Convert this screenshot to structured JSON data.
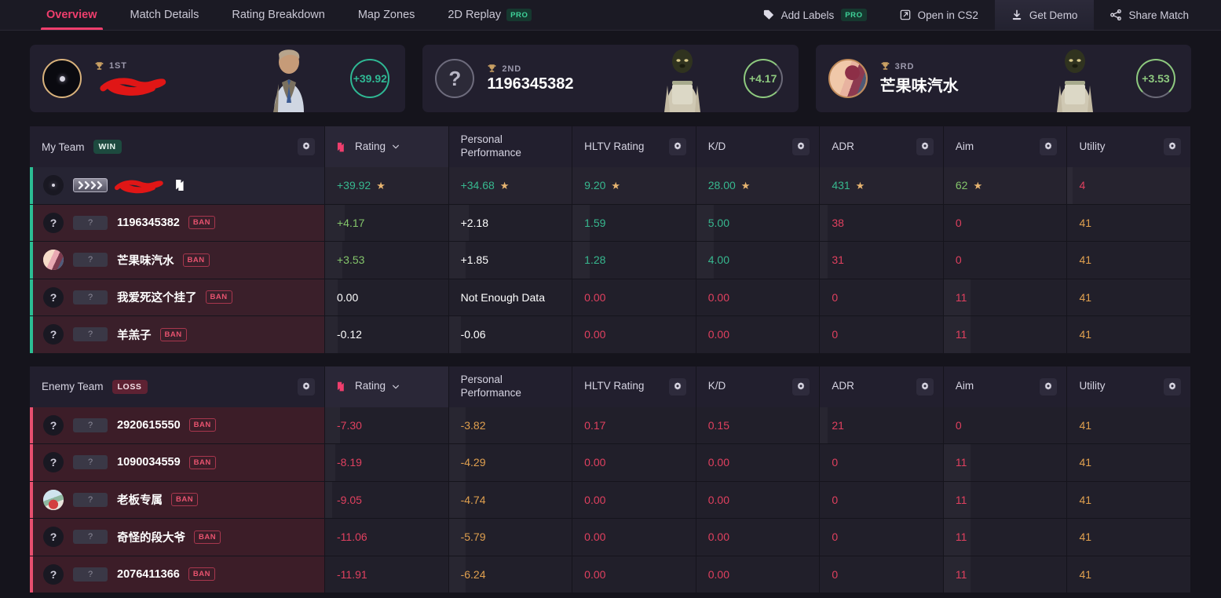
{
  "nav": {
    "tabs": [
      {
        "label": "Overview",
        "active": true,
        "badge": null
      },
      {
        "label": "Match Details",
        "active": false,
        "badge": null
      },
      {
        "label": "Rating Breakdown",
        "active": false,
        "badge": null
      },
      {
        "label": "Map Zones",
        "active": false,
        "badge": null
      },
      {
        "label": "2D Replay",
        "active": false,
        "badge": "PRO"
      }
    ],
    "actions": [
      {
        "label": "Add Labels",
        "icon": "tag-icon",
        "badge": "PRO"
      },
      {
        "label": "Open in CS2",
        "icon": "external-link-icon",
        "badge": null
      },
      {
        "label": "Get Demo",
        "icon": "download-icon",
        "badge": null
      },
      {
        "label": "Share Match",
        "icon": "share-icon",
        "badge": null
      }
    ]
  },
  "podium": [
    {
      "rank": "1ST",
      "name": "",
      "name_redacted": true,
      "score": "+39.92",
      "avatar": "dark-scope"
    },
    {
      "rank": "2ND",
      "name": "1196345382",
      "name_redacted": false,
      "score": "+4.17",
      "avatar": "question-mark"
    },
    {
      "rank": "3RD",
      "name": "芒果味汽水",
      "name_redacted": false,
      "score": "+3.53",
      "avatar": "photo"
    }
  ],
  "columns": [
    {
      "label": "Rating",
      "icon": "leetify-icon",
      "sortable": true,
      "sorted": true,
      "gear": false
    },
    {
      "label": "Personal Performance",
      "icon": null,
      "sortable": false,
      "sorted": false,
      "gear": false
    },
    {
      "label": "HLTV Rating",
      "icon": null,
      "sortable": false,
      "sorted": false,
      "gear": true
    },
    {
      "label": "K/D",
      "icon": null,
      "sortable": false,
      "sorted": false,
      "gear": true
    },
    {
      "label": "ADR",
      "icon": null,
      "sortable": false,
      "sorted": false,
      "gear": true
    },
    {
      "label": "Aim",
      "icon": null,
      "sortable": false,
      "sorted": false,
      "gear": true
    },
    {
      "label": "Utility",
      "icon": null,
      "sortable": false,
      "sorted": false,
      "gear": true
    }
  ],
  "teams": [
    {
      "name": "My Team",
      "result": "WIN",
      "result_type": "win",
      "players": [
        {
          "name": "",
          "name_redacted": true,
          "avatar": "dark-scope",
          "rank_badge": "chevrons",
          "ban": null,
          "is_me": true,
          "stats": [
            {
              "value": "+39.92",
              "color": "green",
              "star": true,
              "bar": 0
            },
            {
              "value": "+34.68",
              "color": "green",
              "star": true,
              "bar": 0
            },
            {
              "value": "9.20",
              "color": "green",
              "star": true,
              "bar": 0
            },
            {
              "value": "28.00",
              "color": "green",
              "star": true,
              "bar": 0
            },
            {
              "value": "431",
              "color": "green",
              "star": true,
              "bar": 0
            },
            {
              "value": "62",
              "color": "lgreen",
              "star": true,
              "bar": 0
            },
            {
              "value": "4",
              "color": "red",
              "star": false,
              "bar": 4
            }
          ]
        },
        {
          "name": "1196345382",
          "name_redacted": false,
          "avatar": "question",
          "rank_badge": "?",
          "ban": "BAN",
          "is_me": false,
          "stats": [
            {
              "value": "+4.17",
              "color": "lgreen",
              "star": false,
              "bar": 16
            },
            {
              "value": "+2.18",
              "color": "white",
              "star": false,
              "bar": 16
            },
            {
              "value": "1.59",
              "color": "green",
              "star": false,
              "bar": 14
            },
            {
              "value": "5.00",
              "color": "green",
              "star": false,
              "bar": 14
            },
            {
              "value": "38",
              "color": "red",
              "star": false,
              "bar": 6
            },
            {
              "value": "0",
              "color": "red",
              "star": false,
              "bar": 0
            },
            {
              "value": "41",
              "color": "orange",
              "star": false,
              "bar": 0
            }
          ]
        },
        {
          "name": "芒果味汽水",
          "name_redacted": false,
          "avatar": "photo1",
          "rank_badge": "?",
          "ban": "BAN",
          "is_me": false,
          "stats": [
            {
              "value": "+3.53",
              "color": "lgreen",
              "star": false,
              "bar": 14
            },
            {
              "value": "+1.85",
              "color": "white",
              "star": false,
              "bar": 14
            },
            {
              "value": "1.28",
              "color": "green",
              "star": false,
              "bar": 14
            },
            {
              "value": "4.00",
              "color": "green",
              "star": false,
              "bar": 14
            },
            {
              "value": "31",
              "color": "red",
              "star": false,
              "bar": 6
            },
            {
              "value": "0",
              "color": "red",
              "star": false,
              "bar": 0
            },
            {
              "value": "41",
              "color": "orange",
              "star": false,
              "bar": 0
            }
          ]
        },
        {
          "name": "我爱死这个挂了",
          "name_redacted": false,
          "avatar": "question",
          "rank_badge": "?",
          "ban": "BAN",
          "is_me": false,
          "stats": [
            {
              "value": "0.00",
              "color": "white",
              "star": false,
              "bar": 10
            },
            {
              "value": "Not Enough Data",
              "color": "white",
              "star": false,
              "bar": 0
            },
            {
              "value": "0.00",
              "color": "red",
              "star": false,
              "bar": 0
            },
            {
              "value": "0.00",
              "color": "red",
              "star": false,
              "bar": 0
            },
            {
              "value": "0",
              "color": "red",
              "star": false,
              "bar": 0
            },
            {
              "value": "11",
              "color": "red",
              "star": false,
              "bar": 22
            },
            {
              "value": "41",
              "color": "orange",
              "star": false,
              "bar": 0
            }
          ]
        },
        {
          "name": "羊羔子",
          "name_redacted": false,
          "avatar": "question",
          "rank_badge": "?",
          "ban": "BAN",
          "is_me": false,
          "stats": [
            {
              "value": "-0.12",
              "color": "white",
              "star": false,
              "bar": 10
            },
            {
              "value": "-0.06",
              "color": "white",
              "star": false,
              "bar": 10
            },
            {
              "value": "0.00",
              "color": "red",
              "star": false,
              "bar": 0
            },
            {
              "value": "0.00",
              "color": "red",
              "star": false,
              "bar": 0
            },
            {
              "value": "0",
              "color": "red",
              "star": false,
              "bar": 0
            },
            {
              "value": "11",
              "color": "red",
              "star": false,
              "bar": 22
            },
            {
              "value": "41",
              "color": "orange",
              "star": false,
              "bar": 0
            }
          ]
        }
      ]
    },
    {
      "name": "Enemy Team",
      "result": "LOSS",
      "result_type": "loss",
      "players": [
        {
          "name": "2920615550",
          "name_redacted": false,
          "avatar": "question",
          "rank_badge": "?",
          "ban": "BAN",
          "is_me": false,
          "stats": [
            {
              "value": "-7.30",
              "color": "red",
              "star": false,
              "bar": 12
            },
            {
              "value": "-3.82",
              "color": "orange",
              "star": false,
              "bar": 14
            },
            {
              "value": "0.17",
              "color": "red",
              "star": false,
              "bar": 0
            },
            {
              "value": "0.15",
              "color": "red",
              "star": false,
              "bar": 0
            },
            {
              "value": "21",
              "color": "red",
              "star": false,
              "bar": 6
            },
            {
              "value": "0",
              "color": "red",
              "star": false,
              "bar": 0
            },
            {
              "value": "41",
              "color": "orange",
              "star": false,
              "bar": 0
            }
          ]
        },
        {
          "name": "1090034559",
          "name_redacted": false,
          "avatar": "question",
          "rank_badge": "?",
          "ban": "BAN",
          "is_me": false,
          "stats": [
            {
              "value": "-8.19",
              "color": "red",
              "star": false,
              "bar": 8
            },
            {
              "value": "-4.29",
              "color": "orange",
              "star": false,
              "bar": 14
            },
            {
              "value": "0.00",
              "color": "red",
              "star": false,
              "bar": 0
            },
            {
              "value": "0.00",
              "color": "red",
              "star": false,
              "bar": 0
            },
            {
              "value": "0",
              "color": "red",
              "star": false,
              "bar": 0
            },
            {
              "value": "11",
              "color": "red",
              "star": false,
              "bar": 22
            },
            {
              "value": "41",
              "color": "orange",
              "star": false,
              "bar": 0
            }
          ]
        },
        {
          "name": "老板专属",
          "name_redacted": false,
          "avatar": "photo2",
          "rank_badge": "?",
          "ban": "BAN",
          "is_me": false,
          "stats": [
            {
              "value": "-9.05",
              "color": "red",
              "star": false,
              "bar": 6
            },
            {
              "value": "-4.74",
              "color": "orange",
              "star": false,
              "bar": 14
            },
            {
              "value": "0.00",
              "color": "red",
              "star": false,
              "bar": 0
            },
            {
              "value": "0.00",
              "color": "red",
              "star": false,
              "bar": 0
            },
            {
              "value": "0",
              "color": "red",
              "star": false,
              "bar": 0
            },
            {
              "value": "11",
              "color": "red",
              "star": false,
              "bar": 22
            },
            {
              "value": "41",
              "color": "orange",
              "star": false,
              "bar": 0
            }
          ]
        },
        {
          "name": "奇怪的段大爷",
          "name_redacted": false,
          "avatar": "question",
          "rank_badge": "?",
          "ban": "BAN",
          "is_me": false,
          "stats": [
            {
              "value": "-11.06",
              "color": "red",
              "star": false,
              "bar": 0
            },
            {
              "value": "-5.79",
              "color": "orange",
              "star": false,
              "bar": 14
            },
            {
              "value": "0.00",
              "color": "red",
              "star": false,
              "bar": 0
            },
            {
              "value": "0.00",
              "color": "red",
              "star": false,
              "bar": 0
            },
            {
              "value": "0",
              "color": "red",
              "star": false,
              "bar": 0
            },
            {
              "value": "11",
              "color": "red",
              "star": false,
              "bar": 22
            },
            {
              "value": "41",
              "color": "orange",
              "star": false,
              "bar": 0
            }
          ]
        },
        {
          "name": "2076411366",
          "name_redacted": false,
          "avatar": "question",
          "rank_badge": "?",
          "ban": "BAN",
          "is_me": false,
          "stats": [
            {
              "value": "-11.91",
              "color": "red",
              "star": false,
              "bar": 0
            },
            {
              "value": "-6.24",
              "color": "orange",
              "star": false,
              "bar": 14
            },
            {
              "value": "0.00",
              "color": "red",
              "star": false,
              "bar": 0
            },
            {
              "value": "0.00",
              "color": "red",
              "star": false,
              "bar": 0
            },
            {
              "value": "0",
              "color": "red",
              "star": false,
              "bar": 0
            },
            {
              "value": "11",
              "color": "red",
              "star": false,
              "bar": 22
            },
            {
              "value": "41",
              "color": "orange",
              "star": false,
              "bar": 0
            }
          ]
        }
      ]
    }
  ],
  "colors": {
    "accent_pink": "#ef3e6d",
    "positive_green": "#37b88f",
    "negative_red": "#e0405f",
    "utility_orange": "#e0a04f",
    "pro_green": "#3fd39a",
    "page_bg": "#15141c",
    "card_bg": "#221f2e"
  }
}
